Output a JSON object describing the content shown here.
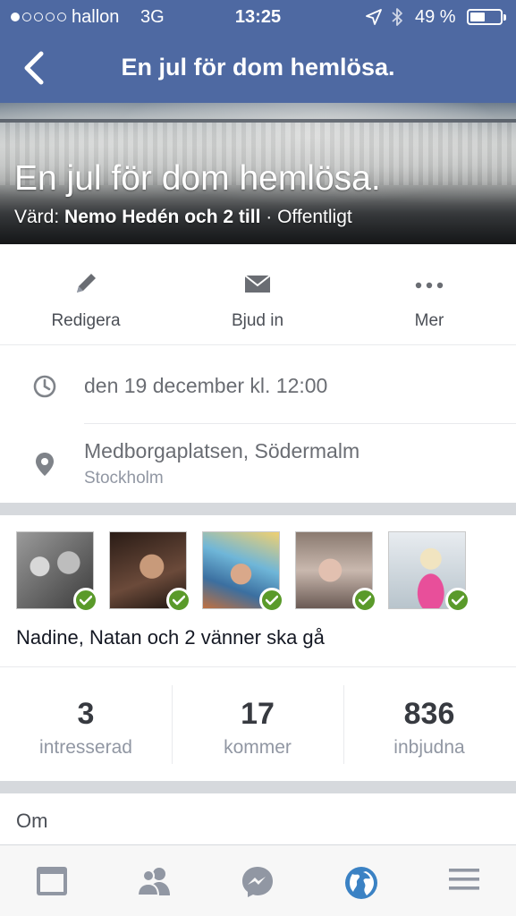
{
  "status_bar": {
    "carrier": "hallon",
    "network": "3G",
    "time": "13:25",
    "battery": "49 %"
  },
  "nav": {
    "title": "En jul för dom hemlösa."
  },
  "cover": {
    "title": "En jul för dom hemlösa.",
    "host_prefix": "Värd: ",
    "host_name": "Nemo Hedén och 2 till",
    "privacy": " · Offentligt"
  },
  "actions": [
    {
      "label": "Redigera",
      "icon": "pencil-icon"
    },
    {
      "label": "Bjud in",
      "icon": "envelope-icon"
    },
    {
      "label": "Mer",
      "icon": "more-icon"
    }
  ],
  "details": {
    "time": "den 19 december kl. 12:00",
    "place": "Medborgaplatsen, Södermalm",
    "city": "Stockholm"
  },
  "friends": {
    "summary": "Nadine, Natan och 2 vänner ska gå",
    "avatars": [
      {
        "name": "friend-avatar-1"
      },
      {
        "name": "friend-avatar-2"
      },
      {
        "name": "friend-avatar-3"
      },
      {
        "name": "friend-avatar-4"
      },
      {
        "name": "friend-avatar-5"
      }
    ]
  },
  "stats": [
    {
      "value": "3",
      "label": "intresserad"
    },
    {
      "value": "17",
      "label": "kommer"
    },
    {
      "value": "836",
      "label": "inbjudna"
    }
  ],
  "about": {
    "heading": "Om"
  },
  "tabs": [
    {
      "icon": "news-feed-icon"
    },
    {
      "icon": "friends-icon"
    },
    {
      "icon": "messenger-icon"
    },
    {
      "icon": "globe-icon"
    },
    {
      "icon": "menu-icon"
    }
  ],
  "colors": {
    "header": "#4e69a2",
    "accent": "#3b82c4",
    "going_check": "#5a9a2a"
  }
}
